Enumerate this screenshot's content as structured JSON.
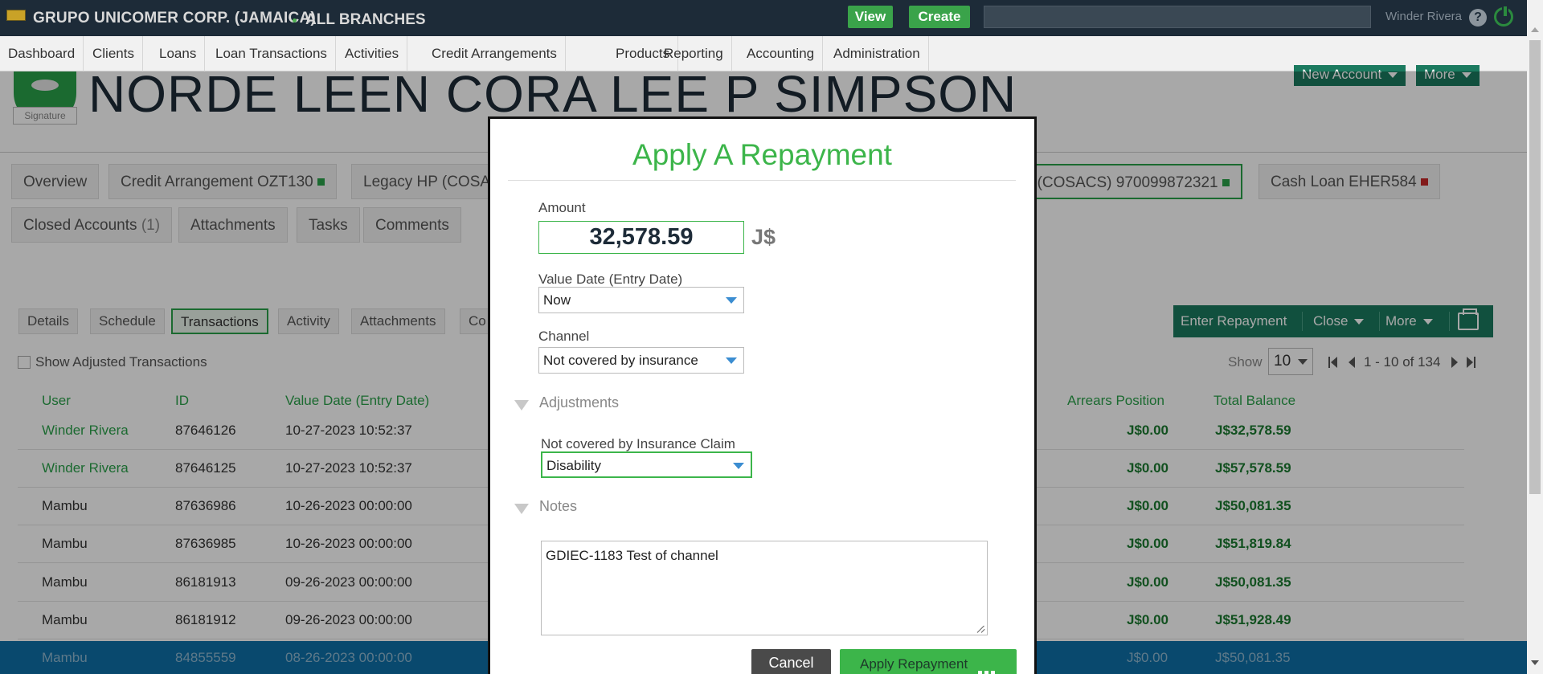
{
  "topbar": {
    "org": "GRUPO UNICOMER CORP. (JAMAICA)",
    "branch": "ALL BRANCHES",
    "view_label": "View",
    "create_label": "Create",
    "user_name": "Winder Rivera",
    "help_label": "?"
  },
  "nav": [
    "Dashboard",
    "Clients",
    "Loans",
    "Loan Transactions",
    "Activities",
    "Credit Arrangements",
    "Products",
    "Reporting",
    "Accounting",
    "Administration"
  ],
  "client": {
    "name": "NORDE LEEN CORA LEE P SIMPSON",
    "signature_label": "Signature",
    "new_account_label": "New Account",
    "more_label": "More"
  },
  "account_tabs": {
    "overview": "Overview",
    "credit_arrangement": "Credit Arrangement OZT130",
    "legacy_hp_1": "Legacy HP (COSA",
    "legacy_hp_2": "P (COSACS) 970099872321",
    "cash_loan": "Cash Loan EHER584",
    "closed_accounts": "Closed Accounts",
    "closed_count": "(1)",
    "attachments": "Attachments",
    "tasks": "Tasks",
    "comments": "Comments"
  },
  "sub_tabs": [
    "Details",
    "Schedule",
    "Transactions",
    "Activity",
    "Attachments",
    "Co"
  ],
  "actions": {
    "enter_repayment": "Enter Repayment",
    "close": "Close",
    "more": "More"
  },
  "filters": {
    "show_adjusted": "Show Adjusted Transactions",
    "show_label": "Show",
    "page_size": "10",
    "range": "1 - 10 of 134"
  },
  "table": {
    "headers": {
      "user": "User",
      "id": "ID",
      "value_date": "Value Date (Entry Date)",
      "arrears": "Arrears Position",
      "total_balance": "Total Balance"
    },
    "rows": [
      {
        "user": "Winder Rivera",
        "id": "87646126",
        "date": "10-27-2023 10:52:37",
        "arrears": "J$0.00",
        "balance": "J$32,578.59"
      },
      {
        "user": "Winder Rivera",
        "id": "87646125",
        "date": "10-27-2023 10:52:37",
        "arrears": "J$0.00",
        "balance": "J$57,578.59"
      },
      {
        "user": "Mambu",
        "id": "87636986",
        "date": "10-26-2023 00:00:00",
        "arrears": "J$0.00",
        "balance": "J$50,081.35"
      },
      {
        "user": "Mambu",
        "id": "87636985",
        "date": "10-26-2023 00:00:00",
        "arrears": "J$0.00",
        "balance": "J$51,819.84"
      },
      {
        "user": "Mambu",
        "id": "86181913",
        "date": "09-26-2023 00:00:00",
        "arrears": "J$0.00",
        "balance": "J$50,081.35"
      },
      {
        "user": "Mambu",
        "id": "86181912",
        "date": "09-26-2023 00:00:00",
        "arrears": "J$0.00",
        "balance": "J$51,928.49"
      },
      {
        "user": "Mambu",
        "id": "84855559",
        "date": "08-26-2023 00:00:00",
        "arrears": "J$0.00",
        "balance": "J$50,081.35"
      }
    ]
  },
  "modal": {
    "title": "Apply A Repayment",
    "amount_label": "Amount",
    "amount_value": "32,578.59",
    "currency": "J$",
    "value_date_label": "Value Date (Entry Date)",
    "value_date_value": "Now",
    "channel_label": "Channel",
    "channel_value": "Not covered by insurance",
    "adjustments_label": "Adjustments",
    "insurance_claim_label": "Not covered by Insurance Claim",
    "insurance_claim_value": "Disability",
    "notes_label": "Notes",
    "notes_value": "GDIEC-1183 Test of channel",
    "cancel_label": "Cancel",
    "apply_label": "Apply Repayment"
  },
  "colors": {
    "topbar_bg": "#1d2b38",
    "brand_green": "#3cb54a",
    "action_teal": "#1b7a5f",
    "overlay": "rgba(0,0,0,0.34)"
  }
}
